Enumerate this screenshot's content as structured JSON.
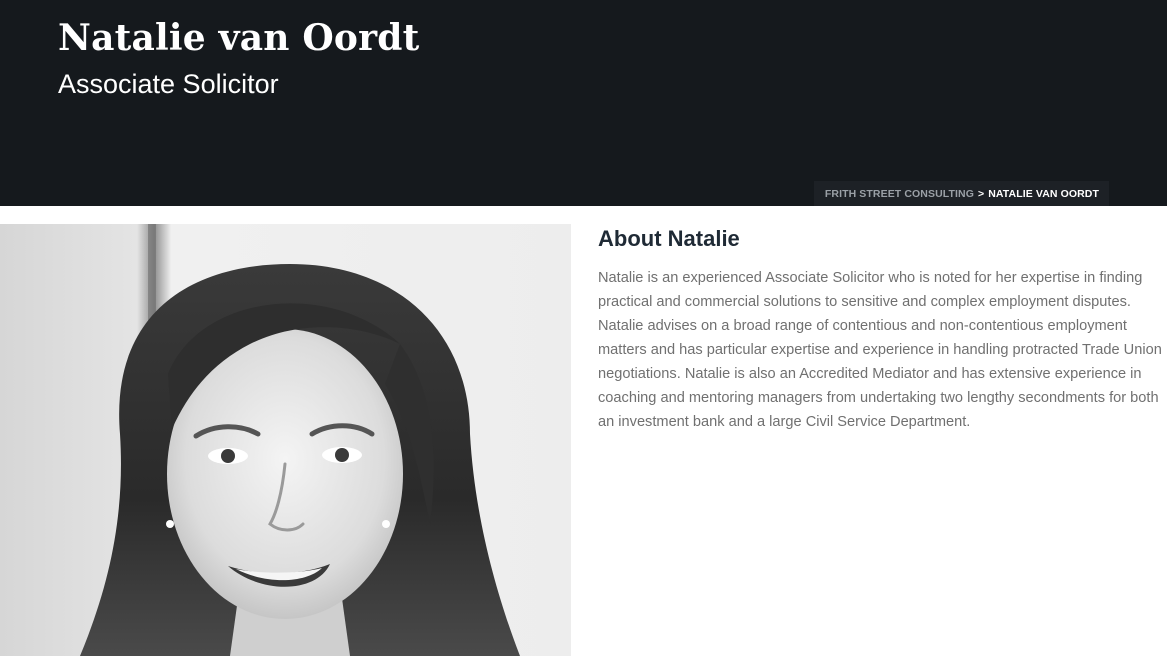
{
  "hero": {
    "name": "Natalie van Oordt",
    "role": "Associate Solicitor"
  },
  "breadcrumb": {
    "home": "FRITH STREET CONSULTING",
    "separator": ">",
    "current": "NATALIE VAN OORDT"
  },
  "about": {
    "title": "About Natalie",
    "body": "Natalie is an experienced Associate Solicitor who is noted for her expertise in finding practical and commercial solutions to sensitive and complex employment disputes. Natalie advises on a broad range of contentious and non-contentious employment matters and has particular expertise and experience in handling protracted Trade Union negotiations. Natalie is also an Accredited Mediator and has extensive experience in coaching and mentoring managers from undertaking two lengthy secondments for both an investment bank and a large Civil Service Department."
  },
  "colors": {
    "hero_background": "#15191d",
    "breadcrumb_background": "#1d2126",
    "heading": "#1f2a35",
    "body_text": "#707070"
  }
}
